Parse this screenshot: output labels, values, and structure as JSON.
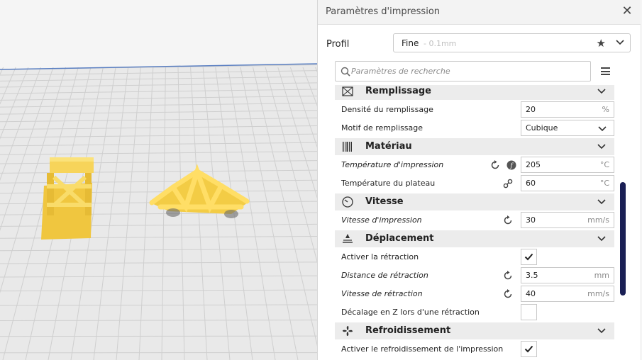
{
  "panel": {
    "title": "Paramètres d'impression",
    "close_label": "✕"
  },
  "profile": {
    "label": "Profil",
    "name": "Fine",
    "sub": " - 0.1mm",
    "star": "★"
  },
  "search": {
    "placeholder": "Paramètres de recherche"
  },
  "categories": {
    "infill": "Remplissage",
    "material": "Matériau",
    "speed": "Vitesse",
    "travel": "Déplacement",
    "cooling": "Refroidissement"
  },
  "settings": {
    "infill_density": {
      "label": "Densité du remplissage",
      "value": "20",
      "unit": "%"
    },
    "infill_pattern": {
      "label": "Motif de remplissage",
      "value": "Cubique"
    },
    "print_temp": {
      "label": "Température d'impression",
      "value": "205",
      "unit": "°C"
    },
    "bed_temp": {
      "label": "Température du plateau",
      "value": "60",
      "unit": "°C"
    },
    "print_speed": {
      "label": "Vitesse d'impression",
      "value": "30",
      "unit": "mm/s"
    },
    "retraction_enable": {
      "label": "Activer la rétraction",
      "checked": true
    },
    "retraction_distance": {
      "label": "Distance de rétraction",
      "value": "3.5",
      "unit": "mm"
    },
    "retraction_speed": {
      "label": "Vitesse de rétraction",
      "value": "40",
      "unit": "mm/s"
    },
    "z_hop": {
      "label": "Décalage en Z lors d'une rétraction",
      "checked": false
    },
    "cooling_enable": {
      "label": "Activer le refroidissement de l'impression",
      "checked": true
    }
  },
  "colors": {
    "model": "#f7d14c",
    "scrollbar": "#1a1f55",
    "grid_line": "#c8c8c8"
  }
}
